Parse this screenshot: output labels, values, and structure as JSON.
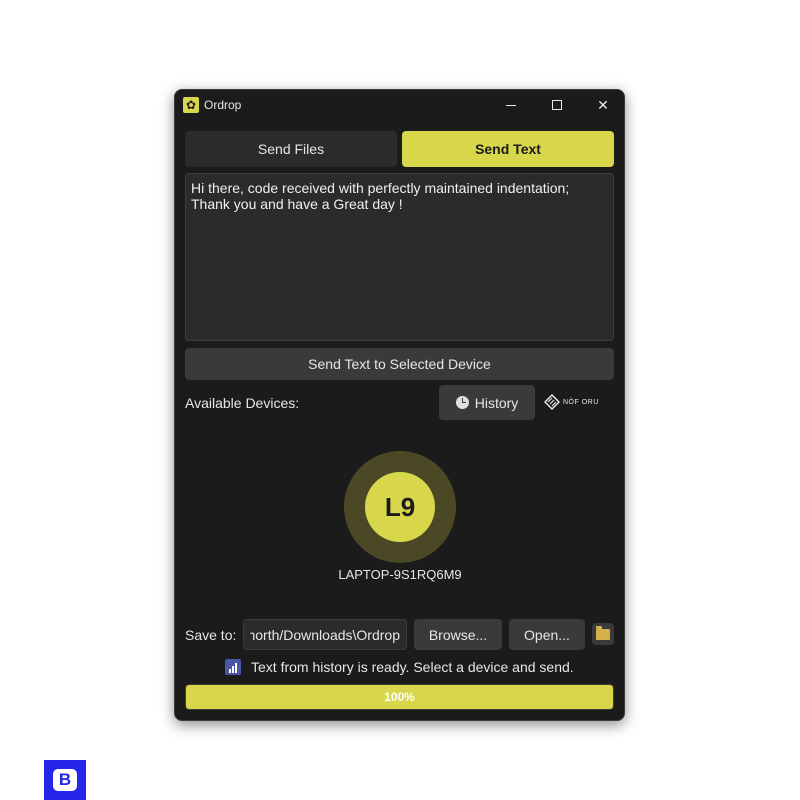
{
  "window": {
    "title": "Ordrop",
    "app_icon": "gear-icon",
    "controls": {
      "minimize": "minimize-icon",
      "maximize": "maximize-icon",
      "close": "✕"
    }
  },
  "tabs": [
    {
      "label": "Send Files",
      "active": false
    },
    {
      "label": "Send Text",
      "active": true
    }
  ],
  "message": {
    "text": "Hi there, code received with perfectly maintained indentation;\nThank you and have a Great day !"
  },
  "send_button": {
    "label": "Send Text to Selected Device"
  },
  "devices": {
    "label": "Available Devices:",
    "history_button": {
      "label": "History",
      "icon": "clock-icon"
    },
    "brand_logo": "NÖF ORU",
    "items": [
      {
        "initials": "L9",
        "name": "LAPTOP-9S1RQ6M9"
      }
    ]
  },
  "save": {
    "label": "Save to:",
    "path": "C:/Users/north/Downloads\\Ordrop",
    "browse_label": "Browse...",
    "open_label": "Open...",
    "folder_icon": "folder-icon"
  },
  "status": {
    "icon": "signal-icon",
    "text": "Text from history is ready. Select a device and send."
  },
  "progress": {
    "value": 1.0,
    "label": "100%"
  },
  "colors": {
    "accent": "#d8d64a",
    "window_bg": "#1b1b1b",
    "button_bg": "#3a3a3a",
    "taskbar_app": "#2626e8"
  },
  "taskbar": {
    "app_icon": "app-b-icon",
    "glyph": "B"
  }
}
